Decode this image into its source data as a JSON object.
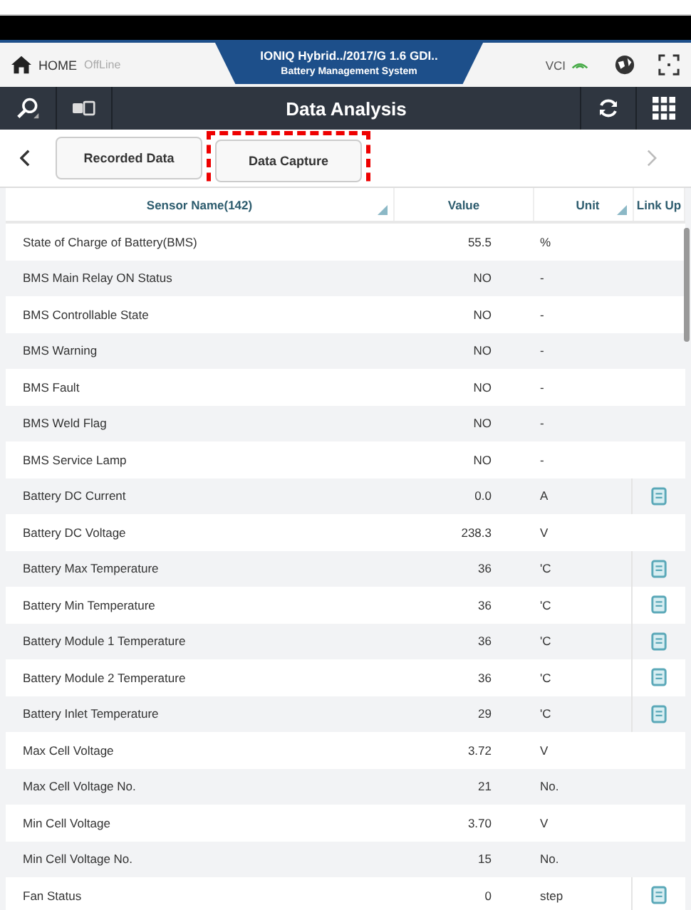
{
  "header": {
    "home": "HOME",
    "status": "OffLine",
    "vehicle": "IONIQ Hybrid../2017/G 1.6 GDI..",
    "system": "Battery Management System",
    "vci": "VCI"
  },
  "toolbar": {
    "title": "Data Analysis"
  },
  "tabs": [
    {
      "label": "Recorded Data",
      "highlighted": false
    },
    {
      "label": "Data Capture",
      "highlighted": true
    }
  ],
  "table": {
    "columns": [
      "Sensor Name(142)",
      "Value",
      "Unit",
      "Link Up"
    ],
    "rows": [
      {
        "name": "State of Charge of Battery(BMS)",
        "value": "55.5",
        "unit": "%",
        "link": false
      },
      {
        "name": "BMS Main Relay ON Status",
        "value": "NO",
        "unit": "-",
        "link": false
      },
      {
        "name": "BMS Controllable State",
        "value": "NO",
        "unit": "-",
        "link": false
      },
      {
        "name": "BMS Warning",
        "value": "NO",
        "unit": "-",
        "link": false
      },
      {
        "name": "BMS Fault",
        "value": "NO",
        "unit": "-",
        "link": false
      },
      {
        "name": "BMS Weld Flag",
        "value": "NO",
        "unit": "-",
        "link": false
      },
      {
        "name": "BMS Service Lamp",
        "value": "NO",
        "unit": "-",
        "link": false
      },
      {
        "name": "Battery DC Current",
        "value": "0.0",
        "unit": "A",
        "link": true
      },
      {
        "name": "Battery DC Voltage",
        "value": "238.3",
        "unit": "V",
        "link": false
      },
      {
        "name": "Battery Max Temperature",
        "value": "36",
        "unit": "'C",
        "link": true
      },
      {
        "name": "Battery Min Temperature",
        "value": "36",
        "unit": "'C",
        "link": true
      },
      {
        "name": "Battery Module 1 Temperature",
        "value": "36",
        "unit": "'C",
        "link": true
      },
      {
        "name": "Battery Module 2 Temperature",
        "value": "36",
        "unit": "'C",
        "link": true
      },
      {
        "name": "Battery Inlet Temperature",
        "value": "29",
        "unit": "'C",
        "link": true
      },
      {
        "name": "Max Cell Voltage",
        "value": "3.72",
        "unit": "V",
        "link": false
      },
      {
        "name": "Max Cell Voltage No.",
        "value": "21",
        "unit": "No.",
        "link": false
      },
      {
        "name": "Min Cell Voltage",
        "value": "3.70",
        "unit": "V",
        "link": false
      },
      {
        "name": "Min Cell Voltage No.",
        "value": "15",
        "unit": "No.",
        "link": false
      },
      {
        "name": "Fan Status",
        "value": "0",
        "unit": "step",
        "link": true
      }
    ]
  }
}
